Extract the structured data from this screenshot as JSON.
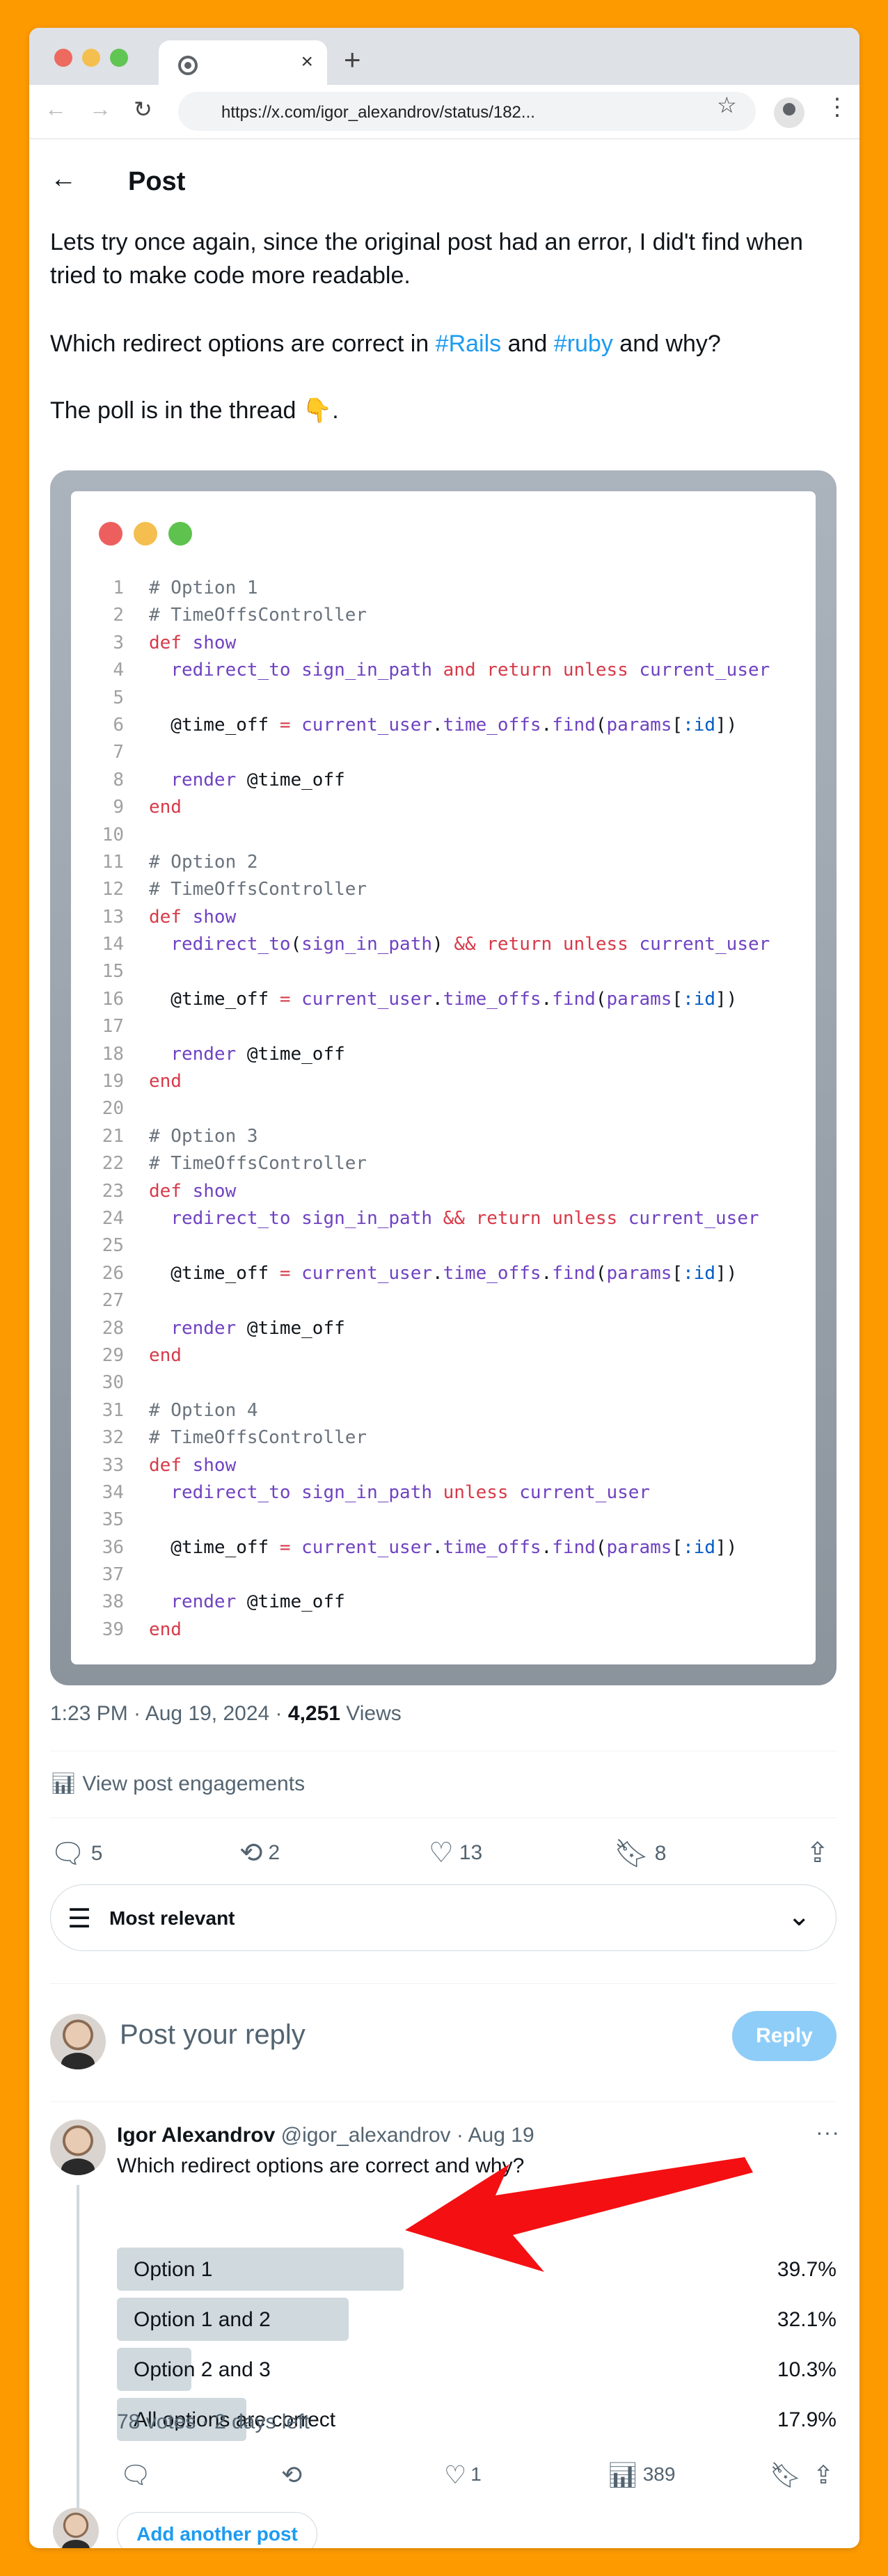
{
  "browser": {
    "url": "https://x.com/igor_alexandrov/status/182...",
    "tab_close": "×",
    "new_tab": "+"
  },
  "header": {
    "title": "Post"
  },
  "tweet": {
    "p1": "Lets try once again, since the original post had an error, I did't find when tried to make code more readable.",
    "p2_before": "Which redirect options are correct in ",
    "p2_tag1": "#Rails",
    "p2_mid": " and ",
    "p2_tag2": "#ruby",
    "p2_after": " and why?",
    "p3": "The poll is in the thread 👇."
  },
  "code": {
    "window_colors": [
      "#ec5f5e",
      "#f4bf4f",
      "#5ec24e"
    ],
    "lines": [
      "# Option 1",
      "# TimeOffsController",
      "def show",
      "  redirect_to sign_in_path and return unless current_user",
      "",
      "  @time_off = current_user.time_offs.find(params[:id])",
      "",
      "  render @time_off",
      "end",
      "",
      "# Option 2",
      "# TimeOffsController",
      "def show",
      "  redirect_to(sign_in_path) && return unless current_user",
      "",
      "  @time_off = current_user.time_offs.find(params[:id])",
      "",
      "  render @time_off",
      "end",
      "",
      "# Option 3",
      "# TimeOffsController",
      "def show",
      "  redirect_to sign_in_path && return unless current_user",
      "",
      "  @time_off = current_user.time_offs.find(params[:id])",
      "",
      "  render @time_off",
      "end",
      "",
      "# Option 4",
      "# TimeOffsController",
      "def show",
      "  redirect_to sign_in_path unless current_user",
      "",
      "  @time_off = current_user.time_offs.find(params[:id])",
      "",
      "  render @time_off",
      "end"
    ]
  },
  "meta": {
    "time": "1:23 PM · Aug 19, 2024 · ",
    "views": "4,251",
    "views_label": " Views"
  },
  "engagements": "View post engagements",
  "actions": {
    "replies": "5",
    "reposts": "2",
    "likes": "13",
    "bookmarks": "8"
  },
  "sort": {
    "label": "Most relevant"
  },
  "reply": {
    "placeholder": "Post your reply",
    "button": "Reply"
  },
  "poll_post": {
    "name": "Igor Alexandrov",
    "handle": " @igor_alexandrov · Aug 19",
    "text": "Which redirect options are correct and why?",
    "options": [
      {
        "label": "Option 1",
        "percent": "39.7%",
        "value": 39.7
      },
      {
        "label": "Option 1 and 2",
        "percent": "32.1%",
        "value": 32.1
      },
      {
        "label": "Option 2 and 3",
        "percent": "10.3%",
        "value": 10.3
      },
      {
        "label": "All options are correct",
        "percent": "17.9%",
        "value": 17.9
      }
    ],
    "votes": "78 votes · 2 days left",
    "likes": "1",
    "views": "389"
  },
  "add_post": "Add another post",
  "colors": {
    "accent": "#1d9bf0",
    "background": "#fd9a00",
    "arrow": "#f40f12"
  }
}
